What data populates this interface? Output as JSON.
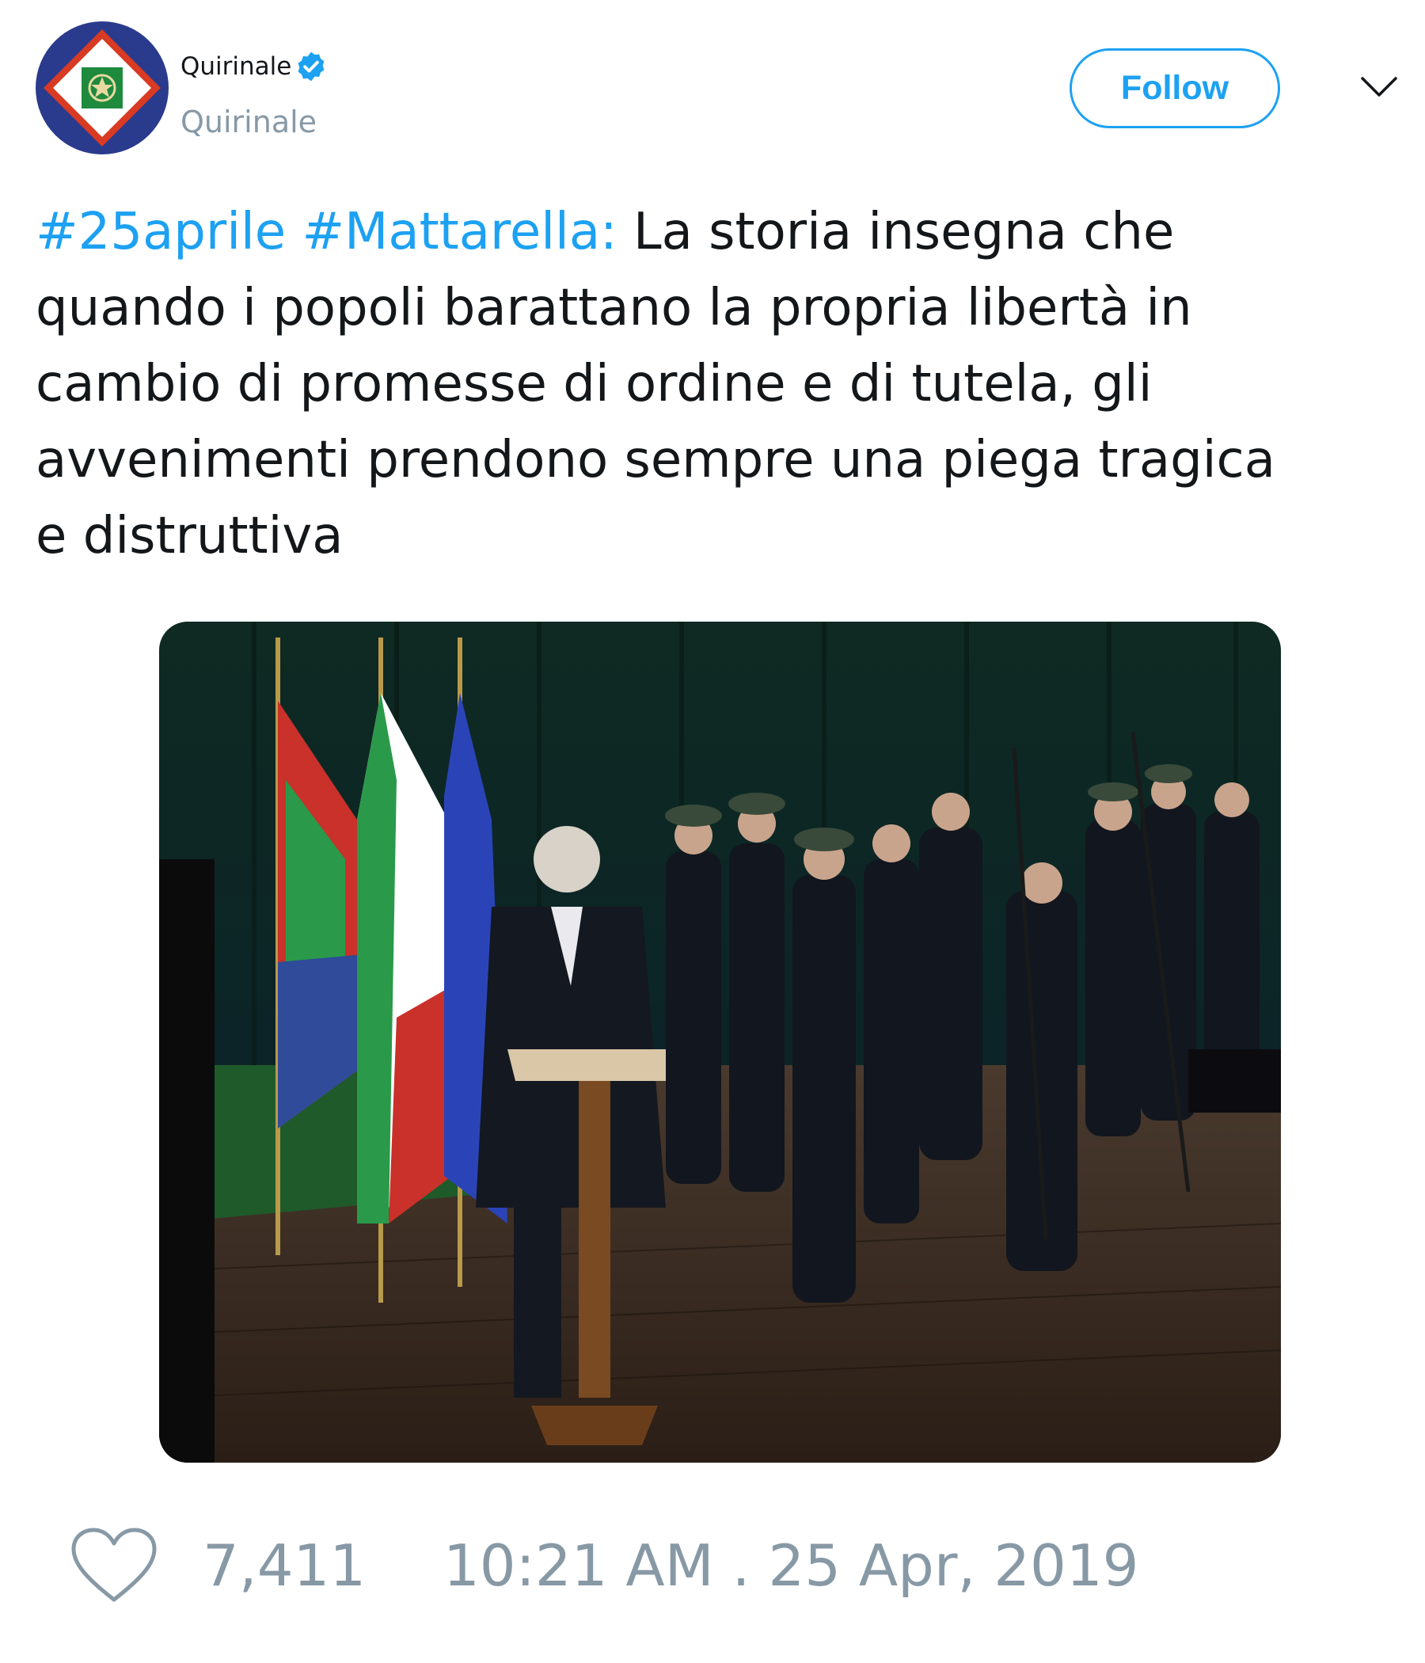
{
  "author": {
    "display_name": "Quirinale",
    "handle": "Quirinale",
    "verified": true,
    "avatar_icon": "presidential-standard-emblem"
  },
  "header": {
    "follow_label": "Follow",
    "menu_icon": "chevron-down-icon"
  },
  "tweet": {
    "hashtag_1": "#25aprile",
    "hashtag_2": "#Mattarella:",
    "text_line_1": "La storia insegna che",
    "text_line_2": "quando i popoli barattano la propria libertà in",
    "text_line_3": "cambio di promesse di ordine e di tutela, gli",
    "text_line_4": "avvenimenti prendono sempre una piega tragica",
    "text_line_5": "e distruttiva"
  },
  "footer": {
    "like_icon": "heart-icon",
    "like_count": "7,411",
    "timestamp": "10:21 AM . 25 Apr, 2019"
  },
  "colors": {
    "accent": "#1da1f2",
    "muted": "#8899a6",
    "text": "#14171a"
  }
}
